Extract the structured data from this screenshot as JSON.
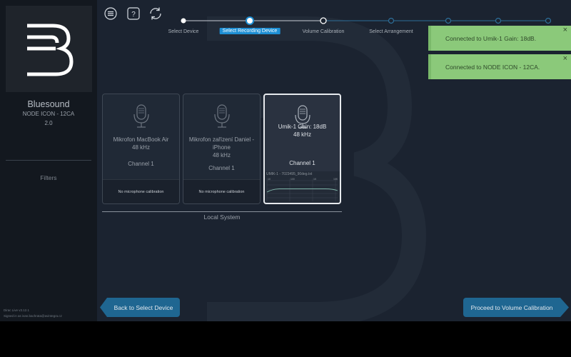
{
  "sidebar": {
    "logo_icon": "bluesound-logo-icon",
    "brand": "Bluesound",
    "device_name": "NODE ICON - 12CA",
    "device_version": "2.0",
    "filters_label": "Filters",
    "version_text": "Dirac Live v3.12.1",
    "signed_in_text": "Signed in as ivan.bachrata@avintegra.cz"
  },
  "toolbar": {
    "menu_icon": "menu-icon",
    "help_icon": "help-icon",
    "refresh_icon": "refresh-icon"
  },
  "stepper": {
    "steps": [
      {
        "label": "Select Device",
        "state": "done"
      },
      {
        "label": "Select Recording Device",
        "state": "active"
      },
      {
        "label": "Volume Calibration",
        "state": "pending"
      },
      {
        "label": "Select Arrangement",
        "state": "pending"
      }
    ],
    "extra_dots": 4
  },
  "notifications": [
    {
      "text": "Connected to Umik-1  Gain: 18dB.",
      "close": "×"
    },
    {
      "text": "Connected to NODE ICON - 12CA.",
      "close": "×"
    }
  ],
  "microphones": [
    {
      "name": "Mikrofon MacBook Air",
      "rate": "48 kHz",
      "channel": "Channel 1",
      "calibration": "No microphone calibration",
      "selected": false
    },
    {
      "name": "Mikrofon zařízení Daniel - iPhone",
      "rate": "48 kHz",
      "channel": "Channel 1",
      "calibration": "No microphone calibration",
      "selected": false
    },
    {
      "name": "Umik-1  Gain: 18dB",
      "rate": "48 kHz",
      "channel": "Channel 1",
      "calibration_file": "UMIK-1 - 7023495_90deg.txt",
      "graph_ticks": [
        "10",
        "100",
        "1K",
        "10K"
      ],
      "selected": true
    }
  ],
  "group_label": "Local System",
  "buttons": {
    "back": "Back to Select Device",
    "next": "Proceed to Volume Calibration"
  },
  "colors": {
    "accent": "#1e8fd4",
    "toast": "#8bc97a",
    "nav_button": "#1f6691"
  }
}
